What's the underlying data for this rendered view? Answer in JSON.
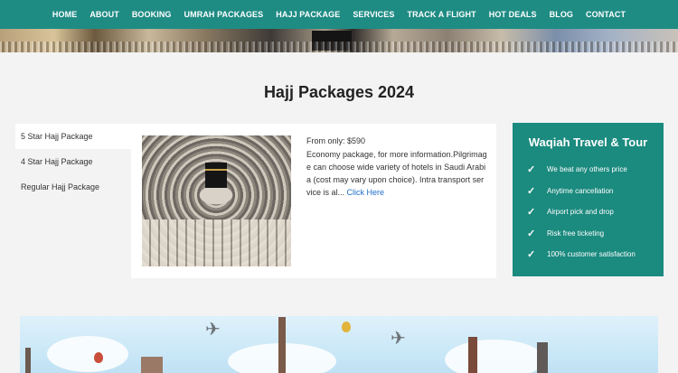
{
  "nav": {
    "items": [
      "HOME",
      "ABOUT",
      "BOOKING",
      "UMRAH PACKAGES",
      "HAJJ PACKAGE",
      "SERVICES",
      "TRACK A FLIGHT",
      "HOT DEALS",
      "BLOG",
      "CONTACT"
    ]
  },
  "page": {
    "title": "Hajj Packages 2024"
  },
  "sidebar": {
    "items": [
      "5 Star Hajj Package",
      "4 Star Hajj Package",
      "Regular Hajj Package"
    ]
  },
  "package": {
    "price": "From only: $590",
    "description": "Economy package, for more information.Pilgrimage can choose wide variety of hotels in Saudi Arabia (cost may vary upon choice). Intra transport service is al...",
    "link": "Click Here"
  },
  "widget": {
    "title": "Waqiah Travel & Tour",
    "items": [
      "We beat any others price",
      "Anytime cancellation",
      "Airport pick and drop",
      "Risk free ticketing",
      "100% customer satisfaction"
    ]
  },
  "colors": {
    "primary": "#1f8c84",
    "link": "#1e6fc8"
  },
  "icons": {
    "checkmark": "check-icon"
  }
}
